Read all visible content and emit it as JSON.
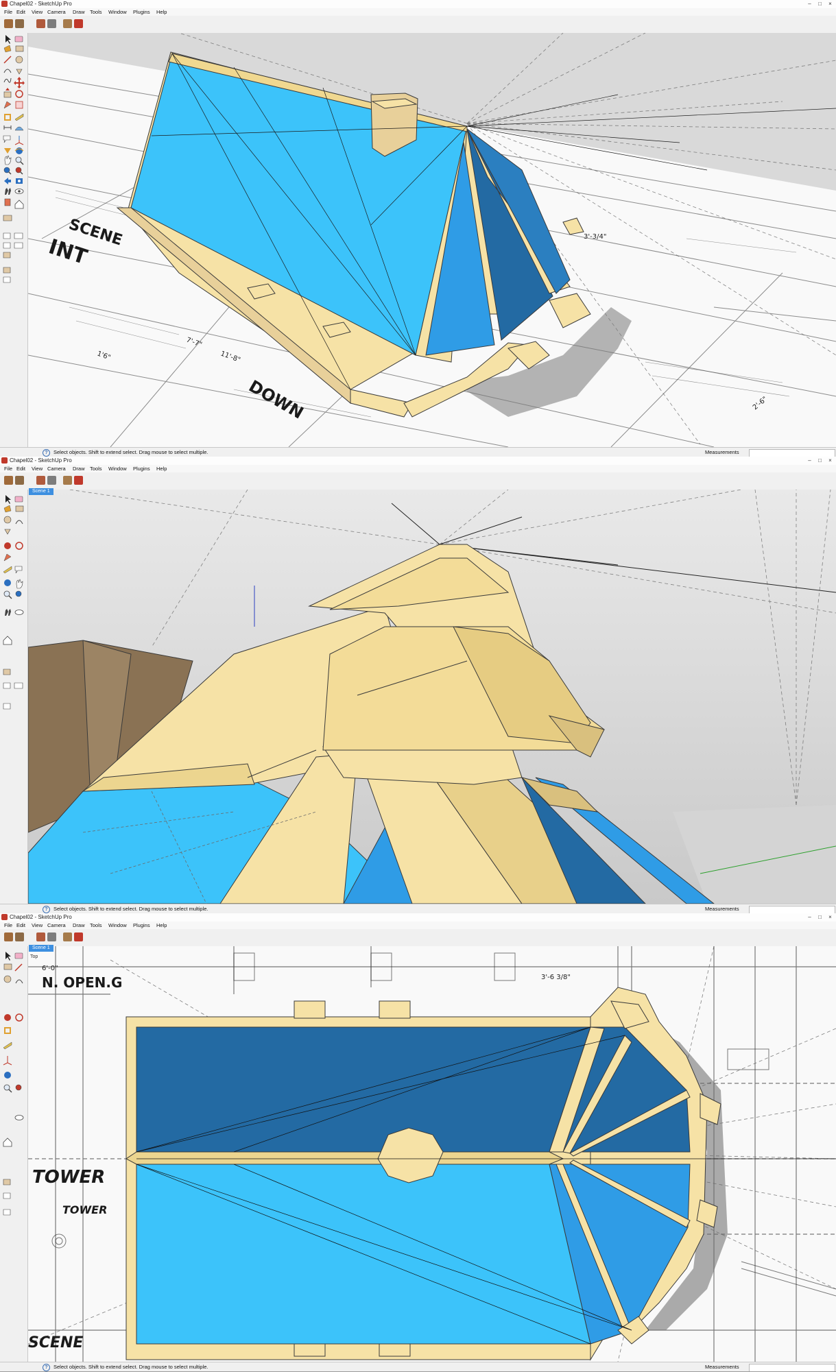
{
  "windows": [
    {
      "title": "Chapel02 - SketchUp Pro",
      "scene_tab": "",
      "view_label": "",
      "drawing_text": {
        "scene": "SCENE",
        "int": "INT",
        "down": "DOWN",
        "dim1": "7'-7\"",
        "dim2": "11'-8\"",
        "dim3": "1'6\"",
        "dim4": "3'-3/4\"",
        "dim5": "2'-6\""
      }
    },
    {
      "title": "Chapel02 - SketchUp Pro",
      "scene_tab": "Scene 1",
      "view_label": "",
      "drawing_text": {}
    },
    {
      "title": "Chapel02 - SketchUp Pro",
      "scene_tab": "Scene 1",
      "view_label": "Top",
      "drawing_text": {
        "opening": "N. OPEN.G",
        "tower": "TOWER",
        "tower2": "TOWER",
        "scene": "SCENE",
        "dim1": "6'-0\"",
        "dim2": "3'-6 3/8\""
      }
    }
  ],
  "menu": [
    "File",
    "Edit",
    "View",
    "Camera",
    "Draw",
    "Tools",
    "Window",
    "Plugins",
    "Help"
  ],
  "window_controls": {
    "minimize": "–",
    "maximize": "□",
    "close": "×"
  },
  "status": {
    "text": "Select objects. Shift to extend select. Drag mouse to select multiple.",
    "help": "?",
    "measurements_label": "Measurements",
    "measurements_value": ""
  },
  "toolbar_icons": [
    "get-models-icon",
    "share-model-icon",
    "share-component-icon",
    "3d-warehouse-icon",
    "extension-warehouse-icon",
    "materials-icon"
  ],
  "tool_icons": [
    "select-icon",
    "eraser-icon",
    "paint-bucket-icon",
    "rectangle-icon",
    "line-icon",
    "circle-icon",
    "arc-icon",
    "polygon-icon",
    "freehand-icon",
    "move-icon",
    "push-pull-icon",
    "rotate-icon",
    "follow-me-icon",
    "scale-icon",
    "offset-icon",
    "tape-measure-icon",
    "dimension-icon",
    "protractor-icon",
    "text-icon",
    "axes-icon",
    "3d-text-icon",
    "orbit-icon",
    "pan-icon",
    "zoom-icon",
    "zoom-window-icon",
    "zoom-extents-icon",
    "previous-view-icon",
    "position-camera-icon",
    "walk-icon",
    "look-around-icon",
    "section-plane-icon",
    "house-icon",
    "sandbox-icon",
    "layers-icon",
    "components-icon",
    "styles-icon",
    "outliner-icon",
    "scenes-icon"
  ],
  "colors": {
    "roof_light": "#3cc3fa",
    "roof_mid": "#2f9ce6",
    "roof_dark": "#236aa3",
    "trim": "#f6e2a6",
    "trim_shade": "#d9c07e",
    "sky": "#d9d9d9",
    "ground_blueprint": "#f7f7f7"
  }
}
